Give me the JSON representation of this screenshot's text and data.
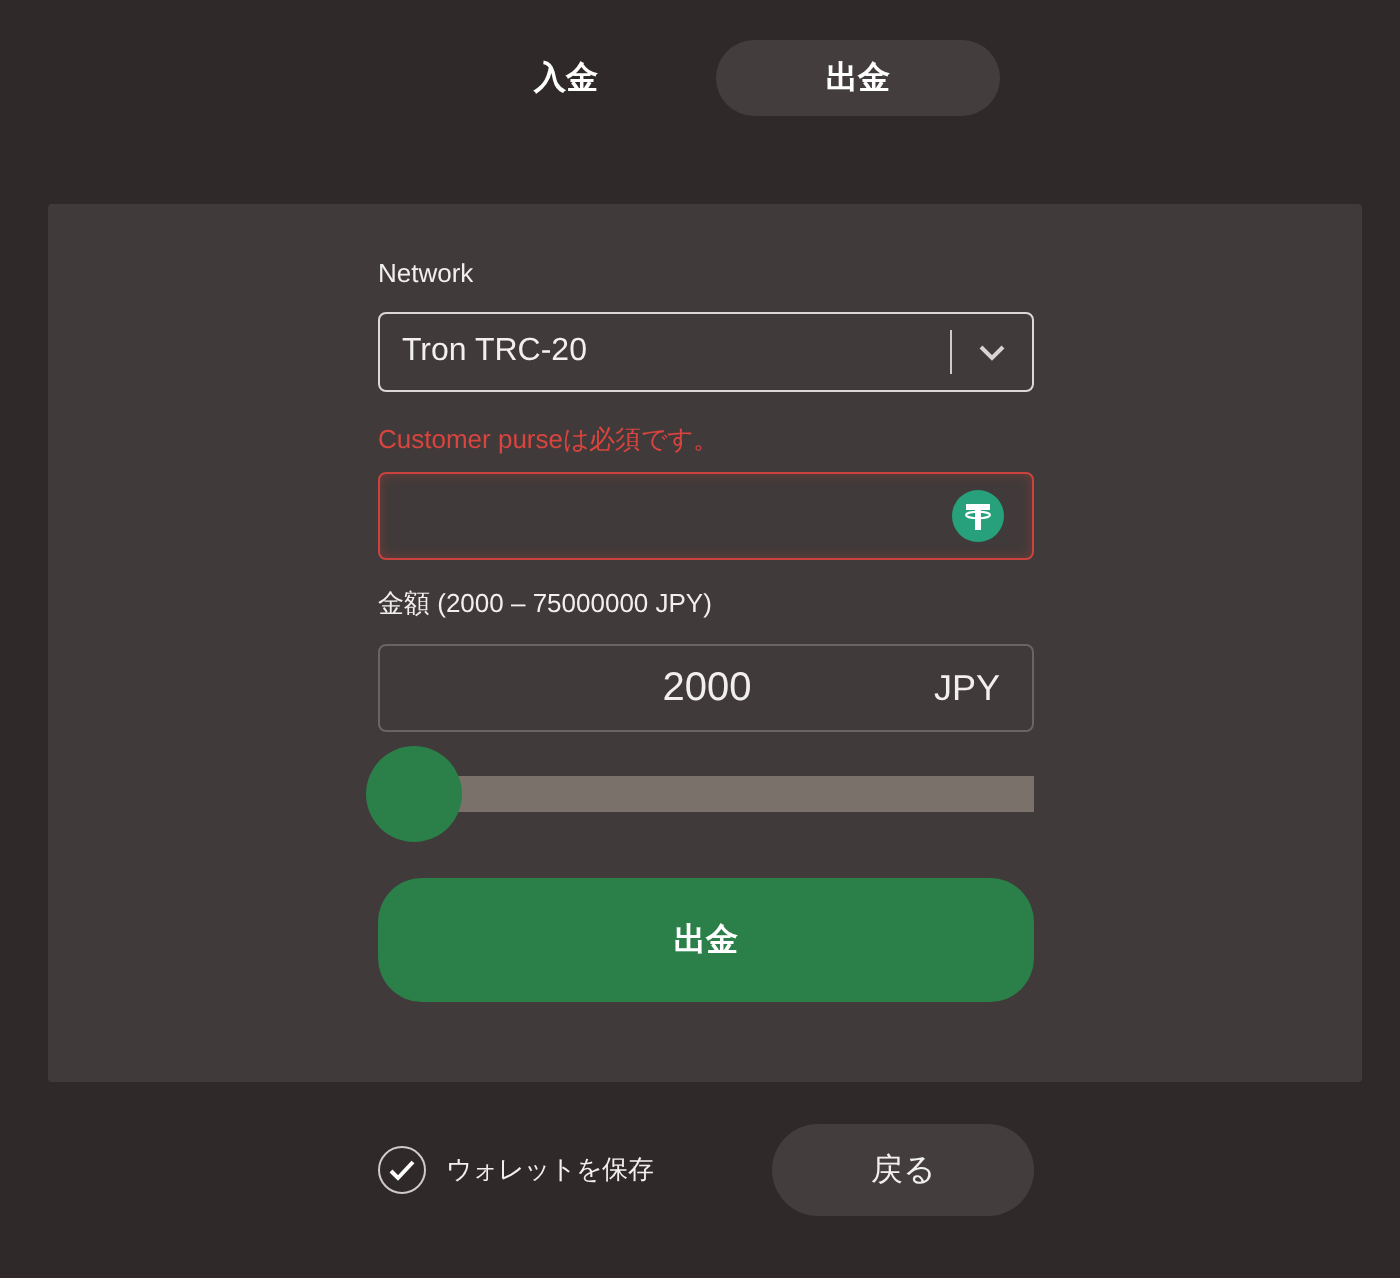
{
  "tabs": [
    {
      "label": "入金",
      "selected": false
    },
    {
      "label": "出金",
      "selected": true
    }
  ],
  "form": {
    "network": {
      "label": "Network",
      "value": "Tron TRC-20"
    },
    "purse": {
      "error": "Customer purseは必須です。",
      "invalid": true
    },
    "amount": {
      "label": "金額 (2000 – 75000000 JPY)",
      "value": "2000",
      "currency": "JPY"
    },
    "slider": {
      "level": 0
    },
    "submit": "出金"
  },
  "footer": {
    "save_wallet": {
      "label": "ウォレットを保存",
      "checked": true
    },
    "back": "戻る"
  }
}
